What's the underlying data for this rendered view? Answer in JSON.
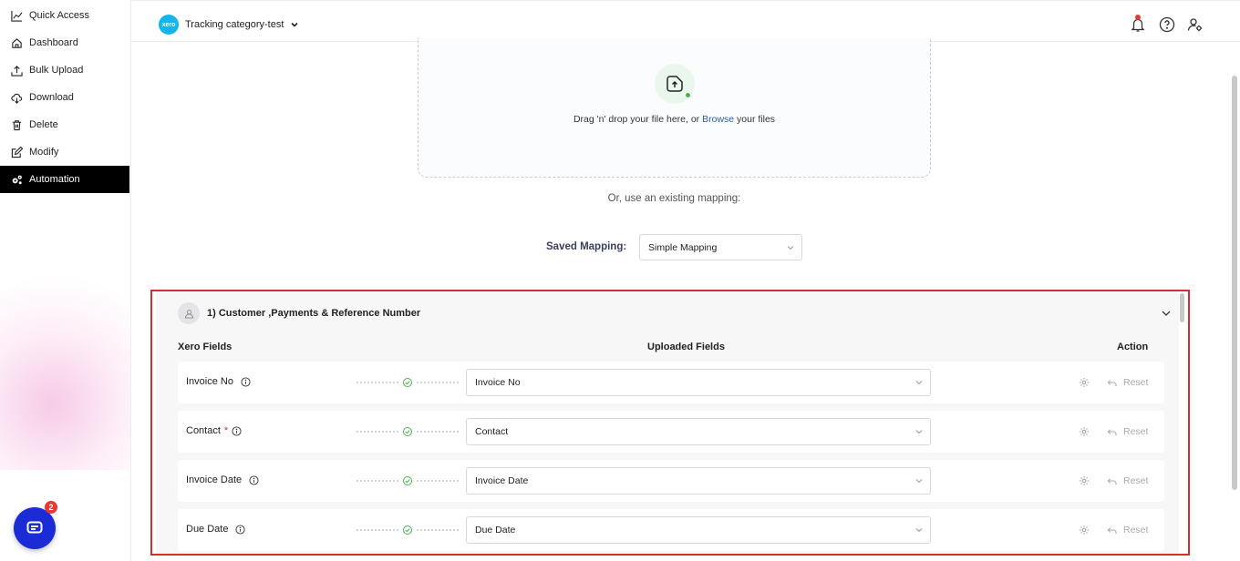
{
  "sidebar": {
    "items": [
      {
        "label": "Quick Access",
        "icon": "chart-icon"
      },
      {
        "label": "Dashboard",
        "icon": "home-icon"
      },
      {
        "label": "Bulk Upload",
        "icon": "upload-icon"
      },
      {
        "label": "Download",
        "icon": "cloud-download-icon"
      },
      {
        "label": "Delete",
        "icon": "trash-icon"
      },
      {
        "label": "Modify",
        "icon": "edit-icon"
      },
      {
        "label": "Automation",
        "icon": "gears-icon",
        "active": true
      }
    ]
  },
  "chat": {
    "badge": "2"
  },
  "header": {
    "org_logo_text": "xero",
    "org_name": "Tracking category-test"
  },
  "upload": {
    "drop_prefix": "Drag 'n' drop your file here, or ",
    "browse": "Browse",
    "drop_suffix": " your files",
    "or_text": "Or, use an existing mapping:"
  },
  "mapping": {
    "label": "Saved Mapping:",
    "selected": "Simple Mapping"
  },
  "section": {
    "title": "1) Customer ,Payments & Reference Number",
    "col_xero": "Xero Fields",
    "col_uploaded": "Uploaded Fields",
    "col_action": "Action",
    "reset_label": "Reset",
    "rows": [
      {
        "field": "Invoice No",
        "required": "",
        "value": "Invoice No"
      },
      {
        "field": "Contact",
        "required": "*",
        "value": "Contact"
      },
      {
        "field": "Invoice Date",
        "required": "",
        "value": "Invoice Date"
      },
      {
        "field": "Due Date",
        "required": "",
        "value": "Due Date"
      }
    ]
  },
  "colors": {
    "accent": "#1b2bd6",
    "highlight": "#d32f2f",
    "success": "#4caf50",
    "link": "#2a5db0"
  }
}
